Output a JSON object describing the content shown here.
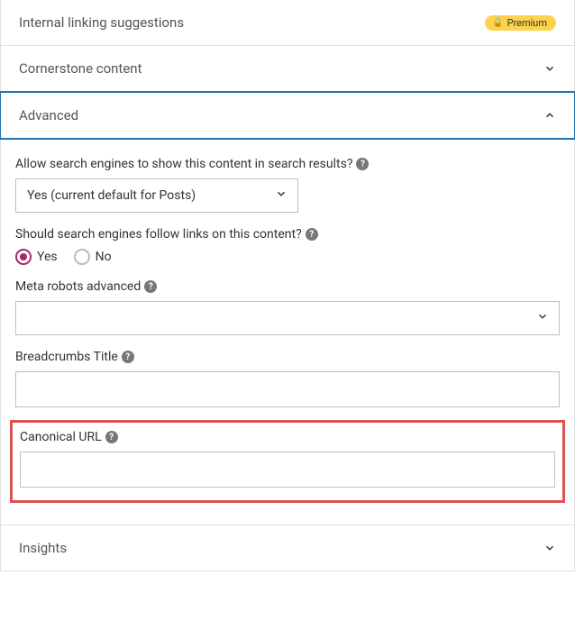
{
  "panels": {
    "internal_linking": {
      "title": "Internal linking suggestions",
      "premium_label": "Premium"
    },
    "cornerstone": {
      "title": "Cornerstone content"
    },
    "advanced": {
      "title": "Advanced",
      "fields": {
        "allow_search": {
          "label": "Allow search engines to show this content in search results?",
          "value": "Yes (current default for Posts)"
        },
        "follow_links": {
          "label": "Should search engines follow links on this content?",
          "options": {
            "yes": "Yes",
            "no": "No"
          },
          "selected": "yes"
        },
        "meta_robots": {
          "label": "Meta robots advanced",
          "value": ""
        },
        "breadcrumbs": {
          "label": "Breadcrumbs Title",
          "value": ""
        },
        "canonical": {
          "label": "Canonical URL",
          "value": ""
        }
      }
    },
    "insights": {
      "title": "Insights"
    }
  }
}
